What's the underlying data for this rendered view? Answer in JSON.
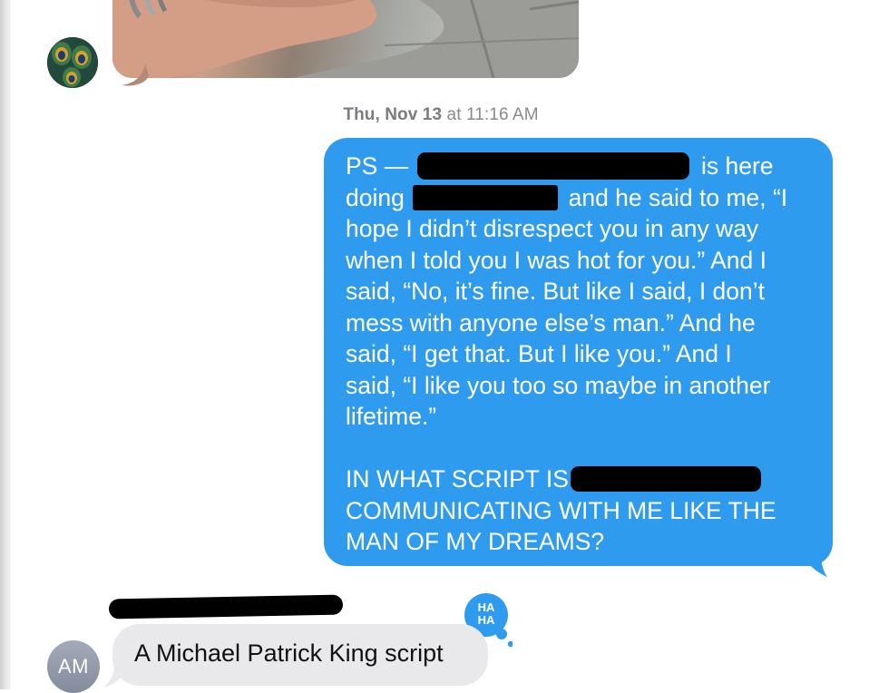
{
  "conversation": {
    "timestamp": {
      "day": "Thu, Nov 13",
      "at": " at ",
      "time": "11:16 AM"
    },
    "outgoing_message": {
      "segments": [
        {
          "text_before": "PS —",
          "text_after": "is here"
        },
        {
          "text_before": "doing",
          "text_after": "and he said to me, “I"
        }
      ],
      "lines": [
        "hope I didn’t disrespect you in any way",
        "when I told you I was hot for you.” And I",
        "said, “No, it’s fine. But like I said, I don’t",
        "mess with anyone else’s man.” And he",
        "said, “I get that. But I like you.” And I",
        "said, “I like you too so maybe in another",
        "lifetime.”"
      ],
      "caps_first": "IN WHAT SCRIPT IS",
      "caps_lines": [
        "COMMUNICATING WITH ME LIKE THE",
        "MAN OF MY DREAMS?"
      ],
      "bubble_color": "#2f9bef"
    },
    "reaction": {
      "line1": "HA",
      "line2": "HA",
      "color": "#2f9bef"
    },
    "incoming_message": {
      "sender_initials": "AM",
      "text": "A Michael Patrick King script",
      "bubble_color": "#e9e9eb"
    },
    "icons": [
      "peacock-avatar",
      "haha-reaction-icon"
    ]
  }
}
